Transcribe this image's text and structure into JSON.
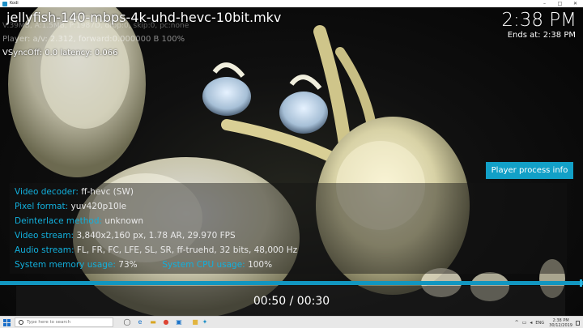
{
  "window": {
    "title": "Kodi",
    "minimize": "–",
    "maximize": "□",
    "close": "✕"
  },
  "osd": {
    "file_title": "jellyfish-140-mbps-4k-uhd-hevc-10bit.mkv",
    "clock": "2:38 PM",
    "ends_at": "Ends at: 2:38 PM",
    "debug_faint": "V:39MB, A:1.5MB, P:1987D, drop:0, skip:0, pc:none",
    "player_line": "Player: a/v: 2.312,  forward:0.000000 B 100%",
    "vsync_line": "VSyncOff: 0.0 latency: 0.066"
  },
  "process_button": "Player process info",
  "info": {
    "video_decoder": {
      "label": "Video decoder:",
      "value": "ff-hevc (SW)"
    },
    "pixel_format": {
      "label": "Pixel format:",
      "value": "yuv420p10le"
    },
    "deinterlace": {
      "label": "Deinterlace method:",
      "value": "unknown"
    },
    "video_stream": {
      "label": "Video stream:",
      "value": "3,840x2,160 px, 1.78 AR, 29.970 FPS"
    },
    "audio_stream": {
      "label": "Audio stream:",
      "value": "FL, FR, FC, LFE, SL, SR, ff-truehd, 32 bits, 48,000 Hz"
    },
    "memory": {
      "label": "System memory usage:",
      "value": "73%"
    },
    "cpu": {
      "label": "System CPU usage:",
      "value": "100%"
    }
  },
  "playback": {
    "time": "00:50 / 00:30",
    "progress_fraction": 1.0
  },
  "taskbar": {
    "search_placeholder": "Type here to search",
    "icons": [
      "task-view-icon",
      "edge-icon",
      "explorer-icon",
      "chrome-icon",
      "store-icon",
      "kodi-icon"
    ],
    "language": "ENG",
    "time": "2:38 PM",
    "date": "30/12/2019"
  },
  "colors": {
    "accent": "#12a0c7",
    "label_blue": "#12b0dd"
  }
}
